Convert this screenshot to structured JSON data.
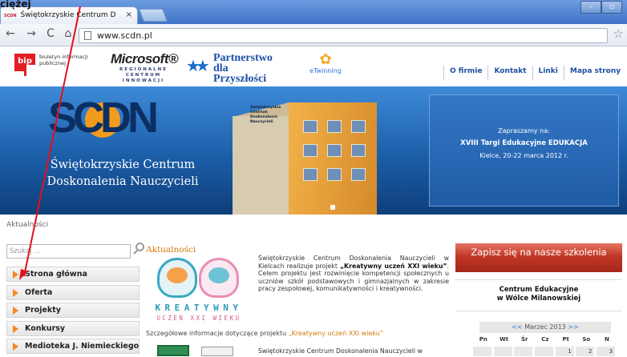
{
  "browser": {
    "tab_title": "Świętokrzyskie Centrum D",
    "tab_favicon": "SCDN",
    "tab_close": "×",
    "url": "www.scdn.pl",
    "controls": [
      "–",
      "▫",
      "✕"
    ]
  },
  "header": {
    "bip_mark": "bip",
    "bip_text": "biuletyn informacji publicznej",
    "microsoft_name": "Microsoft®",
    "microsoft_sub": "REGIONALNE CENTRUM INNOWACJI",
    "partnerstwo_line1": "Partnerstwo",
    "partnerstwo_line2": "dla Przyszłości",
    "etwinning": "eTwinning",
    "nav": [
      "O firmie",
      "Kontakt",
      "Linki",
      "Mapa strony"
    ]
  },
  "banner": {
    "logo": "SCDN",
    "title_line1": "Świętokrzyskie Centrum",
    "title_line2": "Doskonalenia Nauczycieli",
    "building_sign": [
      "Świętokrzyskie",
      "Centrum",
      "Doskonalenia",
      "Nauczycieli"
    ],
    "promo_line1": "Zapraszamy na:",
    "promo_line2": "XVIII Targi Edukacyjne EDUKACJA",
    "promo_line3": "Kielce, 20-22 marca 2012 r."
  },
  "breadcrumb": "Aktualności",
  "sidebar": {
    "search_placeholder": "Szukaj ...",
    "menu": [
      "Strona główna",
      "Oferta",
      "Projekty",
      "Konkursy",
      "Medioteka J. Niemieckiego"
    ]
  },
  "main": {
    "news_title": "Aktualności",
    "kreatywny_top": "KREATYWNY",
    "kreatywny_bottom": "UCZEŃ XXI WIEKU",
    "news1_text_a": "Świętokrzyskie Centrum Doskonalenia Nauczycieli w Kielcach realizuje projekt ",
    "news1_text_b": "„Kreatywny uczeń XXI wieku”",
    "news1_text_c": ". Celem projektu jest rozwinięcie kompetencji społecznych u uczniów szkół podstawowych i gimnazjalnych w zakresie pracy zespołowej, komunikatywności i kreatywności.",
    "details_text": "Szczegółowe informacje dotyczące projektu ",
    "details_link": "„Kreatywny uczeń XXI wieku”",
    "news2_text": "Świętokrzyskie Centrum Doskonalenia Nauczycieli w"
  },
  "right": {
    "register": "Zapisz się na nasze szkolenia",
    "centrum_line1": "Centrum Edukacyjne",
    "centrum_line2": "w Wólce Milanowskiej",
    "cal_prev": "<<",
    "cal_month": "Marzec 2013",
    "cal_next": ">>",
    "cal_days": [
      "Pn",
      "Wt",
      "Śr",
      "Cz",
      "Pt",
      "So",
      "N"
    ],
    "cal_first_row": [
      "",
      "",
      "",
      "",
      "1",
      "2",
      "3"
    ]
  },
  "annotation": {
    "label": "ciężej"
  }
}
